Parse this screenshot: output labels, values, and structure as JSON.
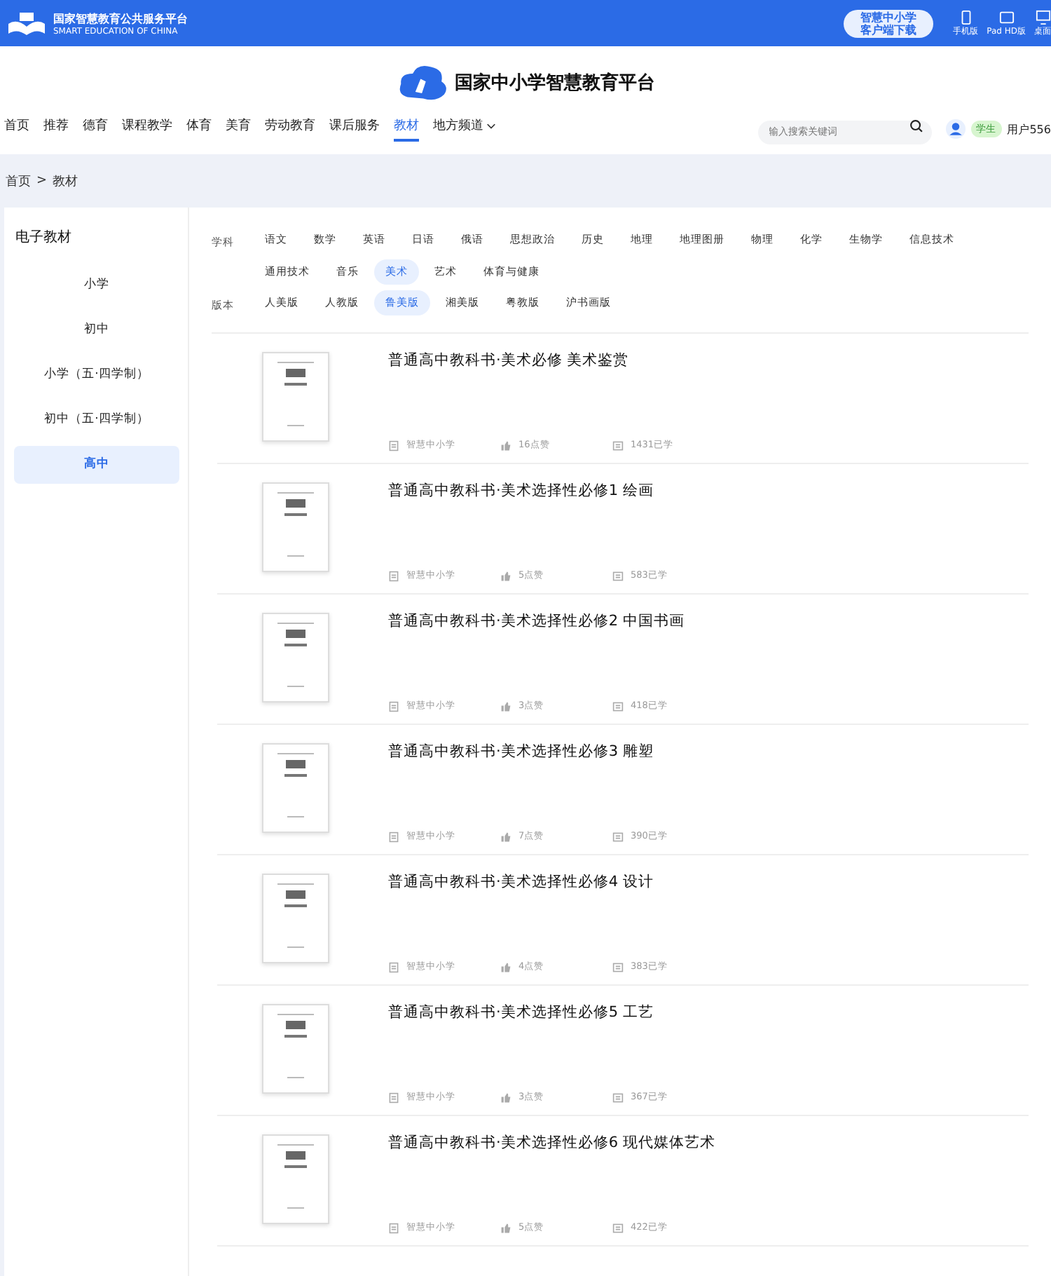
{
  "top_bar": {
    "brand_cn": "国家智慧教育公共服务平台",
    "brand_en": "SMART EDUCATION OF CHINA",
    "download_button": [
      "智慧中小学",
      "客户端下载"
    ],
    "devices": [
      {
        "label": "手机版",
        "kind": "phone"
      },
      {
        "label": "Pad HD版",
        "kind": "tablet"
      },
      {
        "label": "桌面",
        "kind": "desktop"
      }
    ]
  },
  "header": {
    "title": "国家中小学智慧教育平台"
  },
  "nav": {
    "items": [
      {
        "label": "首页",
        "selected": false,
        "dropdown": false
      },
      {
        "label": "推荐",
        "selected": false,
        "dropdown": false
      },
      {
        "label": "德育",
        "selected": false,
        "dropdown": false
      },
      {
        "label": "课程教学",
        "selected": false,
        "dropdown": false
      },
      {
        "label": "体育",
        "selected": false,
        "dropdown": false
      },
      {
        "label": "美育",
        "selected": false,
        "dropdown": false
      },
      {
        "label": "劳动教育",
        "selected": false,
        "dropdown": false
      },
      {
        "label": "课后服务",
        "selected": false,
        "dropdown": false
      },
      {
        "label": "教材",
        "selected": true,
        "dropdown": false
      },
      {
        "label": "地方频道",
        "selected": false,
        "dropdown": true
      }
    ],
    "search": {
      "placeholder": "输入搜索关键词"
    },
    "role_badge": "学生",
    "user": "用户556"
  },
  "breadcrumb": [
    "首页",
    ">",
    "教材"
  ],
  "sidebar": {
    "title": "电子教材",
    "items": [
      {
        "label": "小学",
        "selected": false
      },
      {
        "label": "初中",
        "selected": false
      },
      {
        "label": "小学（五·四学制）",
        "selected": false
      },
      {
        "label": "初中（五·四学制）",
        "selected": false
      },
      {
        "label": "高中",
        "selected": true
      }
    ]
  },
  "filters": [
    {
      "label": "学科",
      "options": [
        {
          "label": "语文",
          "selected": false
        },
        {
          "label": "数学",
          "selected": false
        },
        {
          "label": "英语",
          "selected": false
        },
        {
          "label": "日语",
          "selected": false
        },
        {
          "label": "俄语",
          "selected": false
        },
        {
          "label": "思想政治",
          "selected": false
        },
        {
          "label": "历史",
          "selected": false
        },
        {
          "label": "地理",
          "selected": false
        },
        {
          "label": "地理图册",
          "selected": false
        },
        {
          "label": "物理",
          "selected": false
        },
        {
          "label": "化学",
          "selected": false
        },
        {
          "label": "生物学",
          "selected": false
        },
        {
          "label": "信息技术",
          "selected": false
        },
        {
          "label": "通用技术",
          "selected": false
        },
        {
          "label": "音乐",
          "selected": false
        },
        {
          "label": "美术",
          "selected": true
        },
        {
          "label": "艺术",
          "selected": false
        },
        {
          "label": "体育与健康",
          "selected": false
        }
      ]
    },
    {
      "label": "版本",
      "options": [
        {
          "label": "人美版",
          "selected": false
        },
        {
          "label": "人教版",
          "selected": false
        },
        {
          "label": "鲁美版",
          "selected": true
        },
        {
          "label": "湘美版",
          "selected": false
        },
        {
          "label": "粤教版",
          "selected": false
        },
        {
          "label": "沪书画版",
          "selected": false
        }
      ]
    }
  ],
  "books": [
    {
      "title": "普通高中教科书·美术必修 美术鉴赏",
      "publisher": "智慧中小学",
      "likes": "16点赞",
      "learners": "1431已学"
    },
    {
      "title": "普通高中教科书·美术选择性必修1 绘画",
      "publisher": "智慧中小学",
      "likes": "5点赞",
      "learners": "583已学"
    },
    {
      "title": "普通高中教科书·美术选择性必修2 中国书画",
      "publisher": "智慧中小学",
      "likes": "3点赞",
      "learners": "418已学"
    },
    {
      "title": "普通高中教科书·美术选择性必修3 雕塑",
      "publisher": "智慧中小学",
      "likes": "7点赞",
      "learners": "390已学"
    },
    {
      "title": "普通高中教科书·美术选择性必修4 设计",
      "publisher": "智慧中小学",
      "likes": "4点赞",
      "learners": "383已学"
    },
    {
      "title": "普通高中教科书·美术选择性必修5 工艺",
      "publisher": "智慧中小学",
      "likes": "3点赞",
      "learners": "367已学"
    },
    {
      "title": "普通高中教科书·美术选择性必修6 现代媒体艺术",
      "publisher": "智慧中小学",
      "likes": "5点赞",
      "learners": "422已学"
    }
  ]
}
